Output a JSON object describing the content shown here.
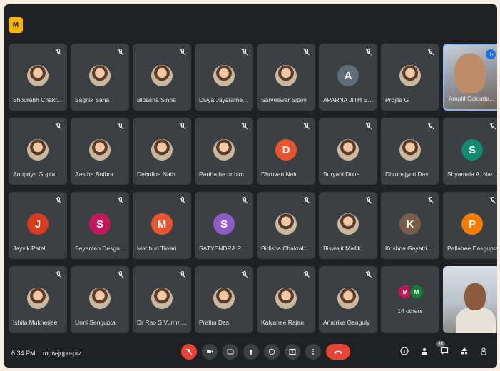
{
  "app": {
    "icon_text": "M",
    "accent": "#f4b400"
  },
  "participants": [
    {
      "name": "Shourabh Chakr...",
      "avatar": "photo"
    },
    {
      "name": "Sagnik Saha",
      "avatar": "photo"
    },
    {
      "name": "Bipasha Sinha",
      "avatar": "photo"
    },
    {
      "name": "Divya Jayarame...",
      "avatar": "photo"
    },
    {
      "name": "Sarveswar Sipoy",
      "avatar": "photo"
    },
    {
      "name": "APARNA JITH En...",
      "avatar": "letter",
      "letter": "A",
      "color": "#5f6d7a"
    },
    {
      "name": "Projita G",
      "avatar": "photo"
    },
    {
      "name": "Amplif Calcutta...",
      "avatar": "video",
      "speaking": true
    },
    {
      "name": "Anupriya Gupta",
      "avatar": "photo"
    },
    {
      "name": "Aastha Bothra",
      "avatar": "photo"
    },
    {
      "name": "Debolina Nath",
      "avatar": "photo"
    },
    {
      "name": "Partha he or him",
      "avatar": "photo"
    },
    {
      "name": "Dhruvan Nair",
      "avatar": "letter",
      "letter": "D",
      "color": "#e8542d"
    },
    {
      "name": "Suryani Dutta",
      "avatar": "photo"
    },
    {
      "name": "Dhrubajyoti Das",
      "avatar": "photo"
    },
    {
      "name": "Shyamala A. Nar...",
      "avatar": "letter",
      "letter": "S",
      "color": "#138a72"
    },
    {
      "name": "Jayvik Patel",
      "avatar": "letter",
      "letter": "J",
      "color": "#d93b1f"
    },
    {
      "name": "Seyanten Desgu...",
      "avatar": "letter",
      "letter": "S",
      "color": "#c2185b"
    },
    {
      "name": "Madhuri Tiwari",
      "avatar": "letter",
      "letter": "M",
      "color": "#e8542d"
    },
    {
      "name": "SATYENDRA PRA...",
      "avatar": "letter",
      "letter": "S",
      "color": "#8e5bc7"
    },
    {
      "name": "Bidisha Chakrab...",
      "avatar": "photo"
    },
    {
      "name": "Biswajit Mallik",
      "avatar": "photo"
    },
    {
      "name": "Krishna Gayatri...",
      "avatar": "letter",
      "letter": "K",
      "color": "#7a5c4a"
    },
    {
      "name": "Pallabee Dasgupta",
      "avatar": "letter",
      "letter": "P",
      "color": "#f57c00"
    },
    {
      "name": "Ishita Mukherjee",
      "avatar": "photo"
    },
    {
      "name": "Urmi Sengupta",
      "avatar": "photo"
    },
    {
      "name": "Dr Rao S Vumme...",
      "avatar": "photo"
    },
    {
      "name": "Pratim Das",
      "avatar": "photo"
    },
    {
      "name": "Kalyanee Rajan",
      "avatar": "photo"
    },
    {
      "name": "Anatrika Ganguly",
      "avatar": "photo"
    },
    {
      "name": "14 others",
      "avatar": "others",
      "minis": [
        {
          "letter": "M",
          "color": "#c2185b"
        },
        {
          "letter": "M",
          "color": "#188038"
        }
      ]
    },
    {
      "name": "",
      "avatar": "self"
    }
  ],
  "bottom": {
    "time": "6:34 PM",
    "meeting_code": "mdw-jqpu-prz",
    "participant_count": "46"
  }
}
